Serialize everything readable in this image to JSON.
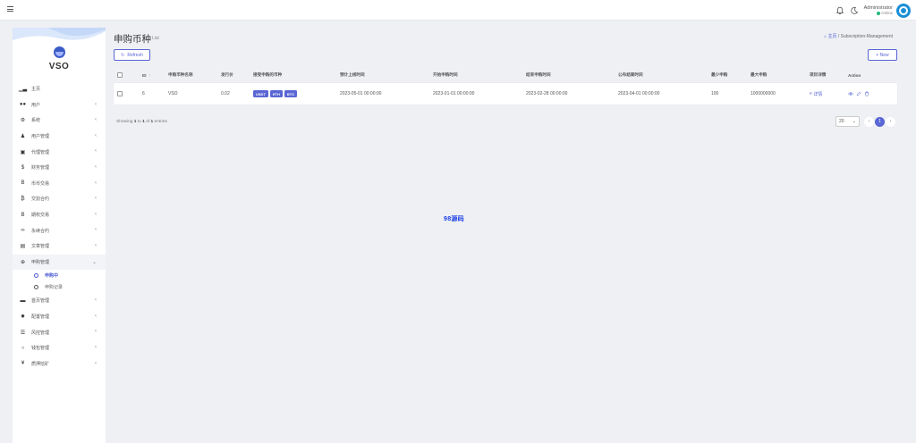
{
  "header": {
    "user_name": "Administrator",
    "user_status": "Online"
  },
  "sidebar": {
    "brand": "VSO",
    "items": [
      {
        "label": "主页",
        "icon": "chart-icon",
        "chevron": false
      },
      {
        "label": "用户",
        "icon": "users-icon",
        "chevron": true
      },
      {
        "label": "系统",
        "icon": "gear-icon",
        "chevron": true
      },
      {
        "label": "用户管理",
        "icon": "person-icon",
        "chevron": true
      },
      {
        "label": "代理管理",
        "icon": "id-card-icon",
        "chevron": true
      },
      {
        "label": "财务管理",
        "icon": "dollar-icon",
        "chevron": true
      },
      {
        "label": "币币交易",
        "icon": "bitcoin-icon",
        "chevron": true
      },
      {
        "label": "交割合约",
        "icon": "bitcoin-circle-icon",
        "chevron": true
      },
      {
        "label": "期权交易",
        "icon": "bitcoin-icon",
        "chevron": true
      },
      {
        "label": "永续合约",
        "icon": "link-icon",
        "chevron": true
      },
      {
        "label": "文章管理",
        "icon": "keyboard-icon",
        "chevron": true
      },
      {
        "label": "申购管理",
        "icon": "plus-circle-icon",
        "chevron": true,
        "open": true
      }
    ],
    "sub_items": [
      {
        "label": "申购中",
        "active": true
      },
      {
        "label": "申购记录",
        "active": false
      }
    ],
    "items_after": [
      {
        "label": "首页管理",
        "icon": "window-icon",
        "chevron": true
      },
      {
        "label": "配置管理",
        "icon": "wrench-icon",
        "chevron": true
      },
      {
        "label": "风控管理",
        "icon": "list-icon",
        "chevron": true
      },
      {
        "label": "钱包管理",
        "icon": "circle-icon",
        "chevron": true
      },
      {
        "label": "质押挖矿",
        "icon": "yen-icon",
        "chevron": true
      }
    ]
  },
  "page": {
    "title": "申购币种",
    "subtitle": "List",
    "breadcrumb_home": "主页",
    "breadcrumb_sep": "/",
    "breadcrumb_current": "Subscription-Management",
    "refresh_label": "Refresh",
    "new_label": "+ New"
  },
  "table": {
    "columns": [
      "ID",
      "申购币种名称",
      "发行价",
      "接受申购的币种",
      "预计上线时间",
      "开始申购时间",
      "结束申购时间",
      "公布结果时间",
      "最少申购",
      "最大申购",
      "项目详情",
      "Action"
    ],
    "id_sort_indicator": "↑",
    "rows": [
      {
        "id": "6",
        "name": "VSO",
        "price": "0.02",
        "coins": [
          "USDT",
          "ETH",
          "BTC"
        ],
        "launch_time": "2023-05-01 00:00:00",
        "start_time": "2023-01-01 00:00:00",
        "end_time": "2023-02-28 00:00:00",
        "publish_time": "2023-04-01 00:00:00",
        "min": "100",
        "max": "1000000000",
        "detail": "详情"
      }
    ]
  },
  "footer": {
    "showing_prefix": "Showing",
    "from": "1",
    "to_word": "to",
    "to": "1",
    "of_word": "of",
    "total": "1",
    "entries_word": "entries",
    "per_page": "20",
    "current_page": "1"
  },
  "watermark": "98源码"
}
